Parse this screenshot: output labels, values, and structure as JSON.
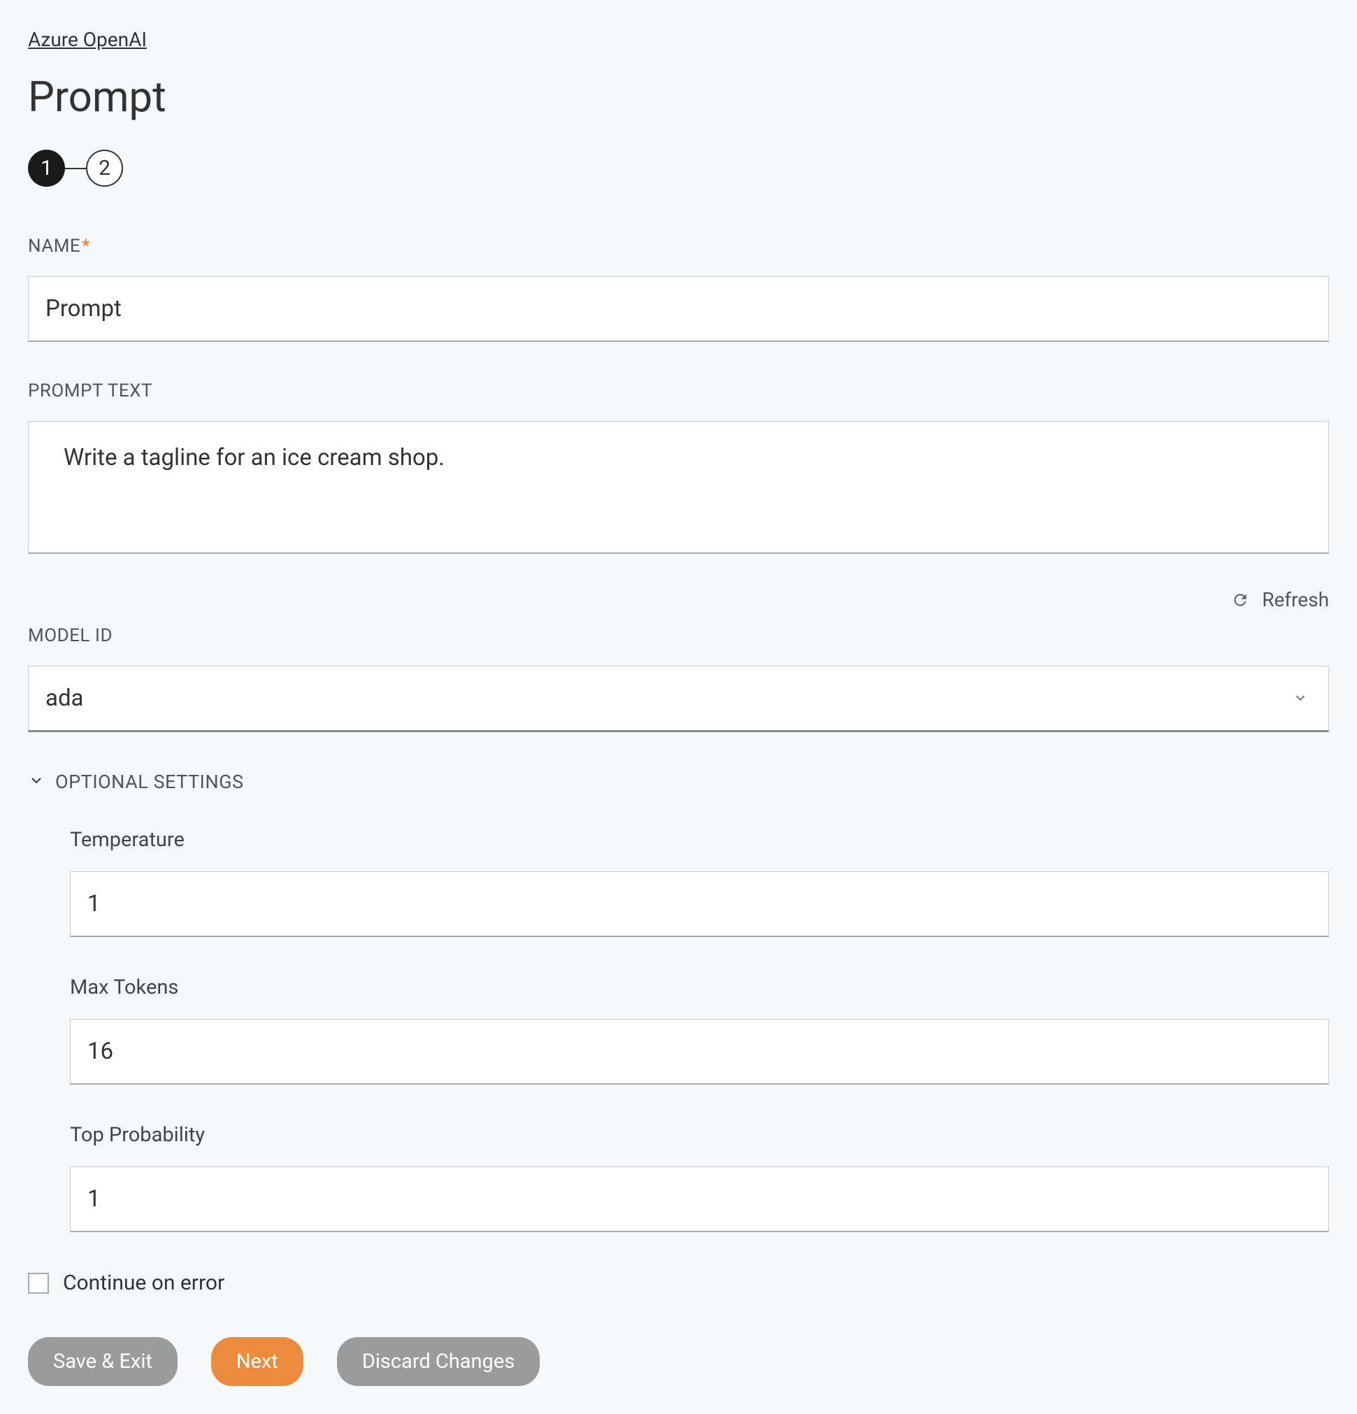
{
  "breadcrumb": "Azure OpenAI",
  "pageTitle": "Prompt",
  "stepper": {
    "step1": "1",
    "step2": "2"
  },
  "nameField": {
    "label": "NAME",
    "value": "Prompt"
  },
  "promptTextField": {
    "label": "PROMPT TEXT",
    "value": "Write a tagline for an ice cream shop."
  },
  "refresh": {
    "label": "Refresh"
  },
  "modelIdField": {
    "label": "MODEL ID",
    "value": "ada"
  },
  "optionalSettings": {
    "label": "OPTIONAL SETTINGS",
    "temperature": {
      "label": "Temperature",
      "value": "1"
    },
    "maxTokens": {
      "label": "Max Tokens",
      "value": "16"
    },
    "topProbability": {
      "label": "Top Probability",
      "value": "1"
    }
  },
  "continueOnError": {
    "label": "Continue on error"
  },
  "buttons": {
    "saveExit": "Save & Exit",
    "next": "Next",
    "discard": "Discard Changes"
  }
}
